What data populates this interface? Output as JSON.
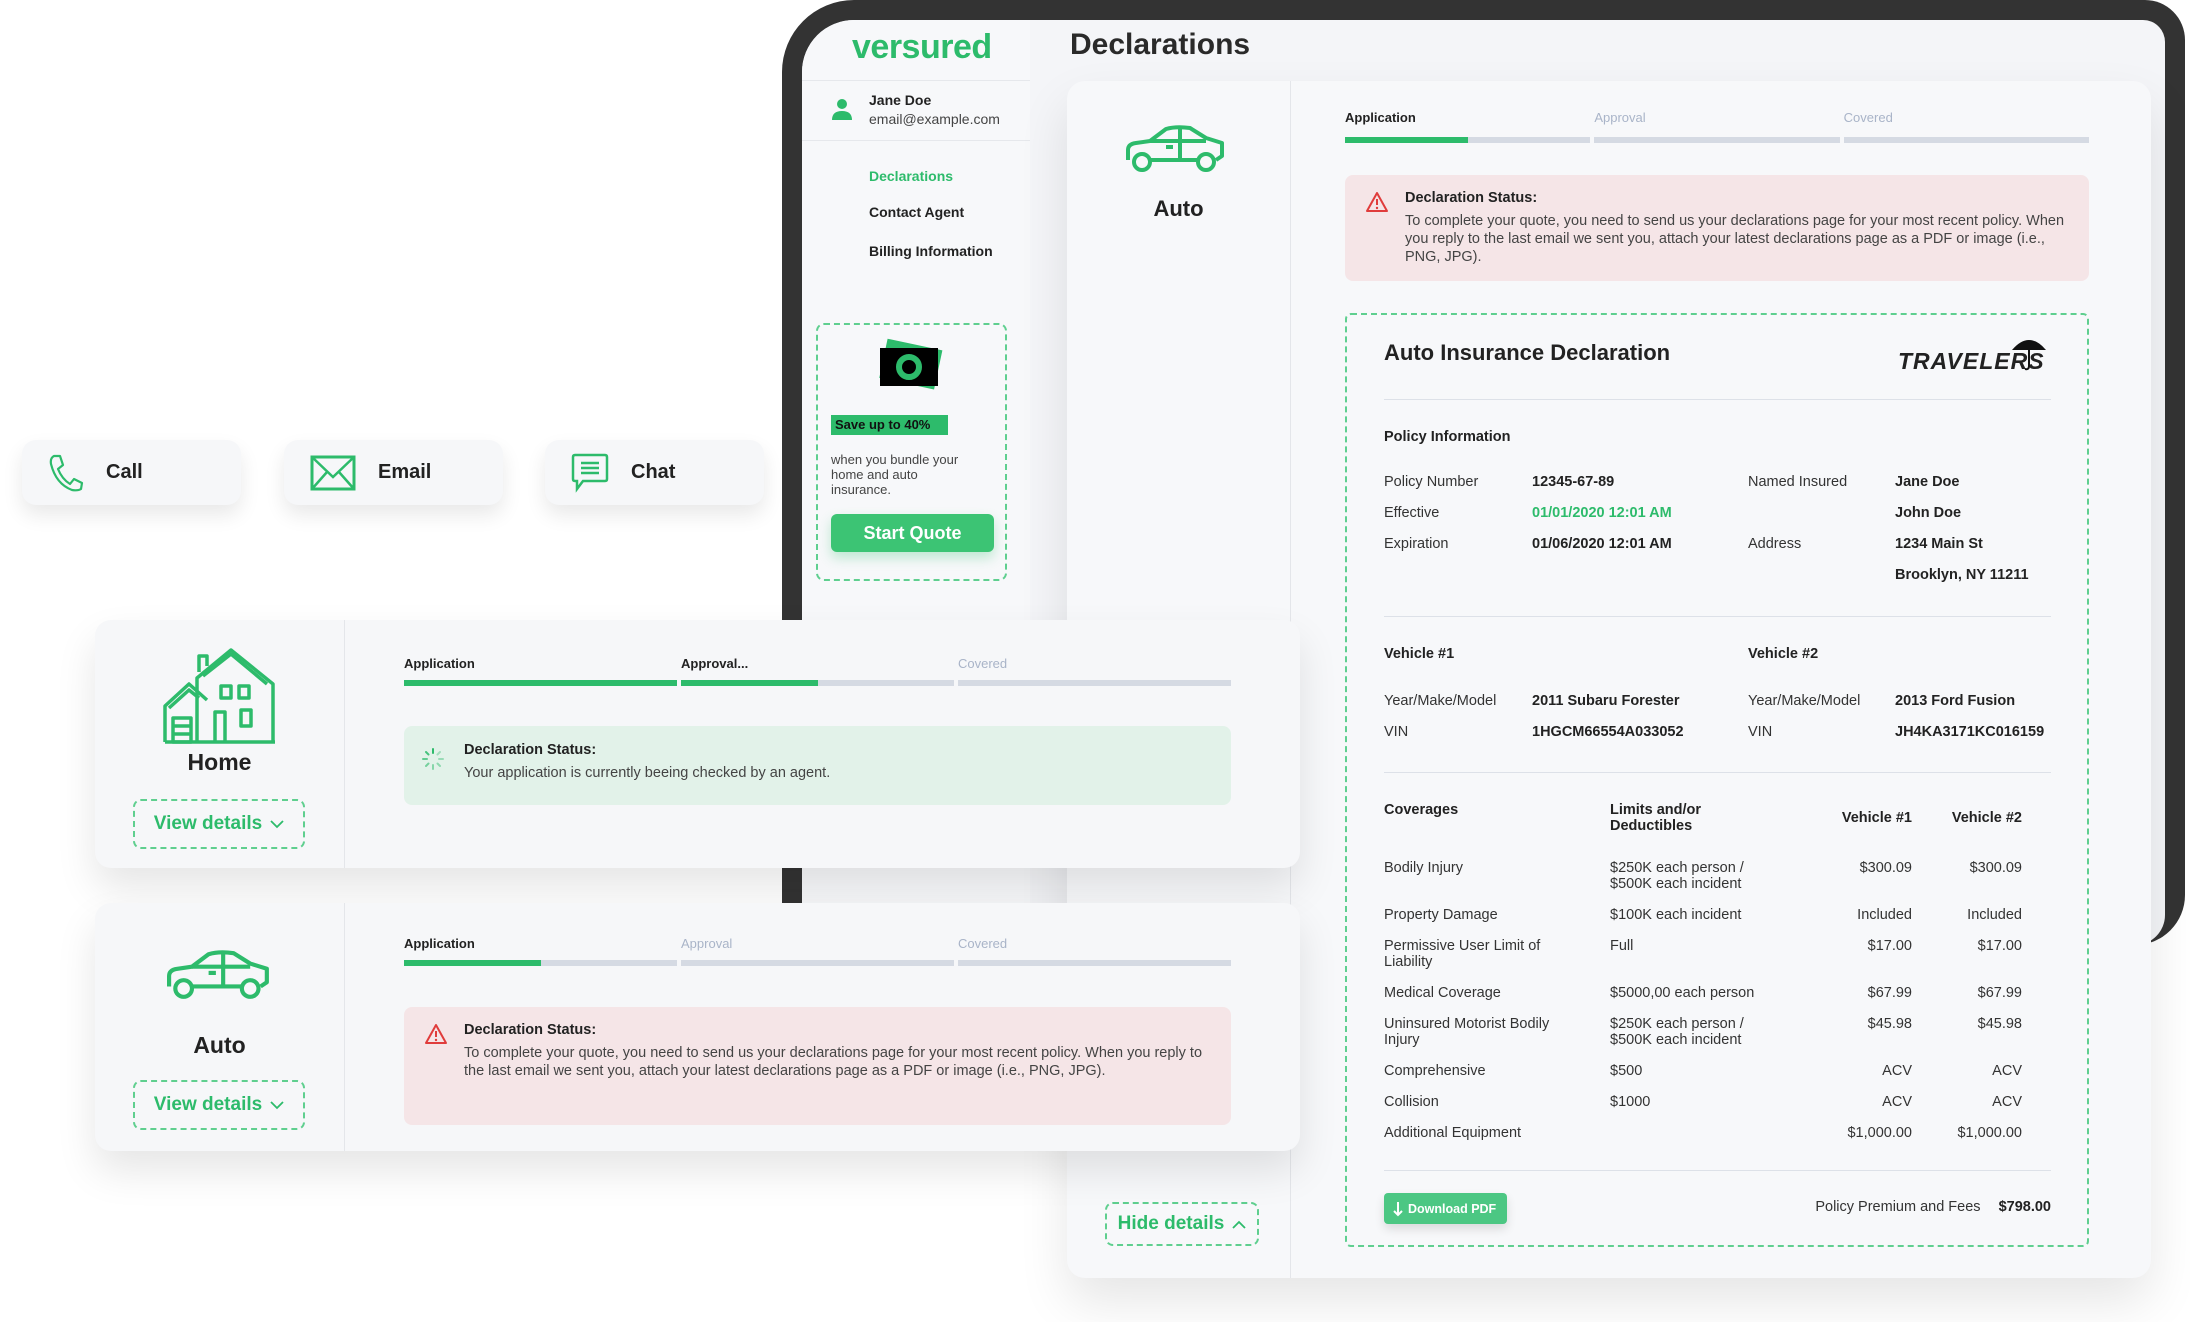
{
  "contact_buttons": [
    {
      "label": "Call",
      "icon": "phone-icon"
    },
    {
      "label": "Email",
      "icon": "envelope-icon"
    },
    {
      "label": "Chat",
      "icon": "chat-icon"
    }
  ],
  "app": {
    "logo": "versured",
    "page_title": "Declarations",
    "user": {
      "name": "Jane Doe",
      "email": "email@example.com"
    },
    "nav": [
      {
        "label": "Declarations",
        "active": true
      },
      {
        "label": "Contact Agent",
        "active": false
      },
      {
        "label": "Billing Information",
        "active": false
      }
    ],
    "promo": {
      "badge": "Save up to 40%",
      "text": "when you bundle your home and auto insurance.",
      "button": "Start Quote"
    }
  },
  "auto_detail": {
    "product": "Auto",
    "steps": [
      {
        "label": "Application",
        "fill": 0.5,
        "state": "active"
      },
      {
        "label": "Approval",
        "fill": 0,
        "state": "inactive"
      },
      {
        "label": "Covered",
        "fill": 0,
        "state": "inactive"
      }
    ],
    "status": {
      "title": "Declaration Status:",
      "text": "To complete your quote, you need to send us your declarations page for your most recent policy. When you reply to the last email we sent you, attach your latest declarations page as a PDF or image (i.e., PNG, JPG)."
    },
    "hide_details": "Hide details",
    "declaration": {
      "title": "Auto Insurance Declaration",
      "carrier_logo": "TRAVELERS",
      "policy_heading": "Policy Information",
      "policy_rows": [
        {
          "l1": "Policy Number",
          "v1": "12345-67-89",
          "l2": "Named Insured",
          "v2": "Jane Doe"
        },
        {
          "l1": "Effective",
          "v1": "01/01/2020 12:01 AM",
          "l2": "",
          "v2": "John Doe"
        },
        {
          "l1": "Expiration",
          "v1": "01/06/2020 12:01 AM",
          "l2": "Address",
          "v2": "1234 Main St"
        },
        {
          "l1": "",
          "v1": "",
          "l2": "",
          "v2": "Brooklyn, NY 11211"
        }
      ],
      "vehicles": [
        {
          "heading": "Vehicle #1",
          "ymm_label": "Year/Make/Model",
          "ymm": "2011 Subaru Forester",
          "vin_label": "VIN",
          "vin": "1HGCM66554A033052"
        },
        {
          "heading": "Vehicle #2",
          "ymm_label": "Year/Make/Model",
          "ymm": "2013 Ford Fusion",
          "vin_label": "VIN",
          "vin": "JH4KA3171KC016159"
        }
      ],
      "coverage_headers": {
        "coverage": "Coverages",
        "limits": "Limits and/or\nDeductibles",
        "v1": "Vehicle #1",
        "v2": "Vehicle #2"
      },
      "coverages": [
        {
          "name": "Bodily Injury",
          "limit": "$250K each person /\n$500K each incident",
          "v1": "$300.09",
          "v2": "$300.09"
        },
        {
          "name": "Property Damage",
          "limit": "$100K each incident",
          "v1": "Included",
          "v2": "Included"
        },
        {
          "name": "Permissive User Limit of\nLiability",
          "limit": "Full",
          "v1": "$17.00",
          "v2": "$17.00"
        },
        {
          "name": "Medical Coverage",
          "limit": "$5000,00 each person",
          "v1": "$67.99",
          "v2": "$67.99"
        },
        {
          "name": "Uninsured Motorist Bodily\nInjury",
          "limit": "$250K each person /\n$500K each incident",
          "v1": "$45.98",
          "v2": "$45.98"
        },
        {
          "name": "Comprehensive",
          "limit": "$500",
          "v1": "ACV",
          "v2": "ACV"
        },
        {
          "name": "Collision",
          "limit": "$1000",
          "v1": "ACV",
          "v2": "ACV"
        },
        {
          "name": "Additional Equipment",
          "limit": "",
          "v1": "$1,000.00",
          "v2": "$1,000.00"
        }
      ],
      "download_button": "Download PDF",
      "premium_label": "Policy Premium and Fees",
      "premium_value": "$798.00"
    }
  },
  "cards": [
    {
      "product": "Home",
      "icon": "house-icon",
      "view_details": "View details",
      "steps": [
        {
          "label": "Application",
          "fill": 1,
          "state": "active"
        },
        {
          "label": "Approval...",
          "fill": 0.5,
          "state": "active"
        },
        {
          "label": "Covered",
          "fill": 0,
          "state": "inactive"
        }
      ],
      "status": {
        "type": "info",
        "title": "Declaration Status:",
        "text": "Your application is currently beeing checked by an agent."
      }
    },
    {
      "product": "Auto",
      "icon": "car-icon",
      "view_details": "View details",
      "steps": [
        {
          "label": "Application",
          "fill": 0.5,
          "state": "active"
        },
        {
          "label": "Approval",
          "fill": 0,
          "state": "inactive"
        },
        {
          "label": "Covered",
          "fill": 0,
          "state": "inactive"
        }
      ],
      "status": {
        "type": "error",
        "title": "Declaration Status:",
        "text": "To complete your quote, you need to send us your declarations page for your most recent policy. When you reply to the last email we sent you, attach your latest declarations page as a PDF or image (i.e., PNG, JPG)."
      }
    }
  ],
  "colors": {
    "accent": "#2dbb6b",
    "error": "#e03c3c",
    "error_bg": "#f5e5e7",
    "info_bg": "#e2f2e9",
    "frame": "#333333"
  }
}
